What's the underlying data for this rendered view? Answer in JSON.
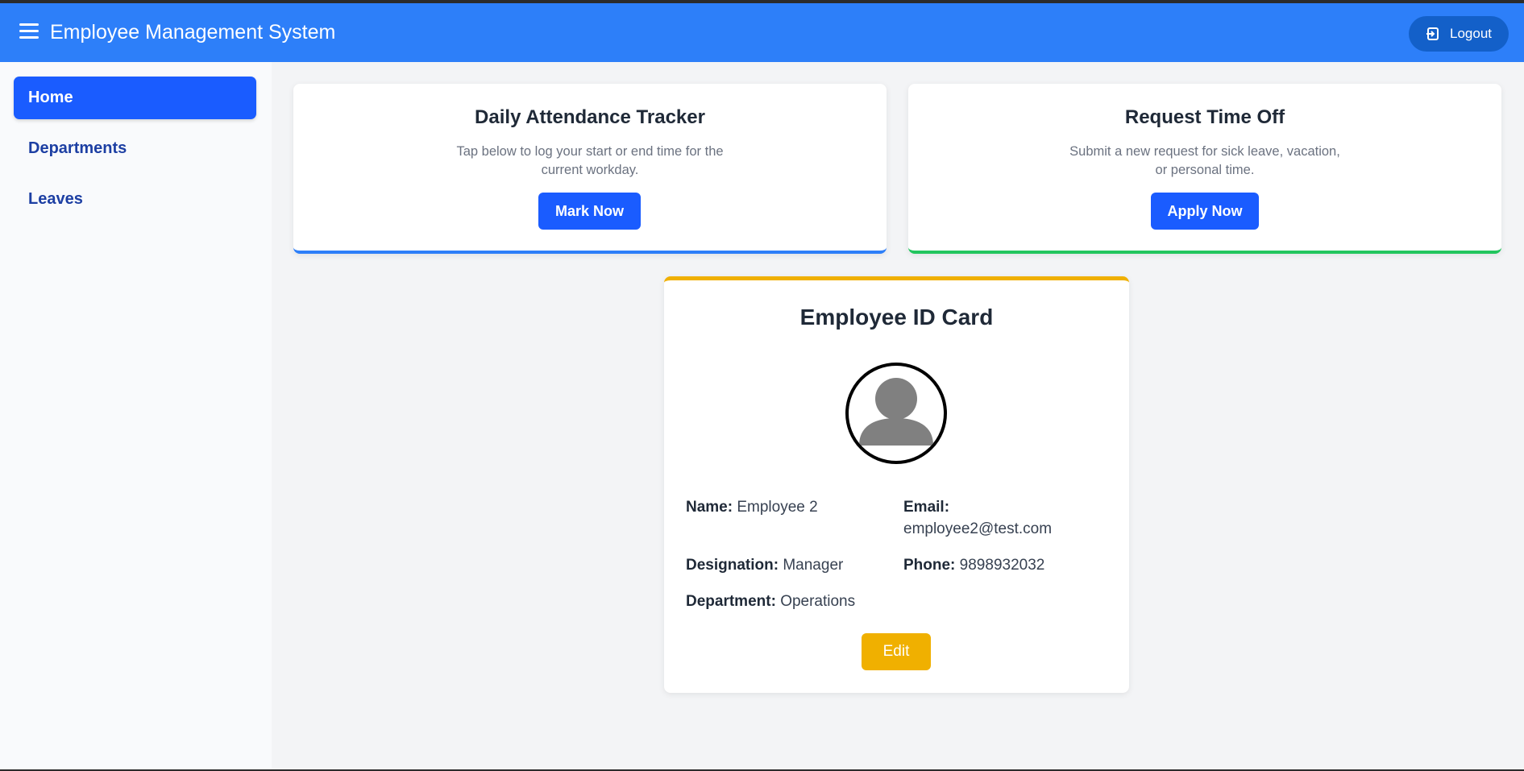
{
  "header": {
    "title": "Employee Management System",
    "logout_label": "Logout"
  },
  "sidebar": {
    "items": [
      {
        "label": "Home"
      },
      {
        "label": "Departments"
      },
      {
        "label": "Leaves"
      }
    ]
  },
  "attendance": {
    "title": "Daily Attendance Tracker",
    "desc_line1": "Tap below to log your start or end time for the",
    "desc_line2": "current workday.",
    "button": "Mark Now"
  },
  "timeoff": {
    "title": "Request Time Off",
    "desc_line1": "Submit a new request for sick leave, vacation,",
    "desc_line2": "or personal time.",
    "button": "Apply Now"
  },
  "id_card": {
    "title": "Employee ID Card",
    "name_label": "Name:",
    "name": "Employee 2",
    "email_label": "Email:",
    "email": "employee2@test.com",
    "designation_label": "Designation:",
    "designation": "Manager",
    "phone_label": "Phone:",
    "phone": "9898932032",
    "department_label": "Department:",
    "department": "Operations",
    "edit_label": "Edit"
  },
  "colors": {
    "primary": "#2d7ff9",
    "accent_green": "#22c55e",
    "accent_yellow": "#f0b000"
  }
}
